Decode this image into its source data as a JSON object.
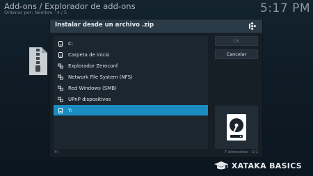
{
  "background": {
    "title": "Add-ons / Explorador de add-ons",
    "subtitle": "Ordenar por: Nombre  ·  4 / 5",
    "clock": "5:17 PM"
  },
  "dialog": {
    "title": "Instalar desde un archivo .zip",
    "items": [
      {
        "label": "C:",
        "icon": "drive-icon"
      },
      {
        "label": "Carpeta de inicio",
        "icon": "drive-icon"
      },
      {
        "label": "Explorador Zeroconf",
        "icon": "network-icon"
      },
      {
        "label": "Network File System (NFS)",
        "icon": "network-icon"
      },
      {
        "label": "Red Windows (SMB)",
        "icon": "network-icon"
      },
      {
        "label": "UPnP dispositivos",
        "icon": "network-icon"
      },
      {
        "label": "Y:",
        "icon": "drive-icon",
        "selected": true
      }
    ],
    "ok_label": "OK",
    "cancel_label": "Cancelar",
    "footer_path": "Y:\\",
    "footer_count": "7 elementos - 1/1",
    "preview_icon": "hard-drive-icon"
  },
  "brand": {
    "text": "XATAKA BASICS",
    "icon": "graduation-cap-icon"
  },
  "colors": {
    "accent": "#1a8cc2",
    "header": "#2a3b47",
    "dialog_bg": "#161e26",
    "list_bg": "#1c262f"
  }
}
